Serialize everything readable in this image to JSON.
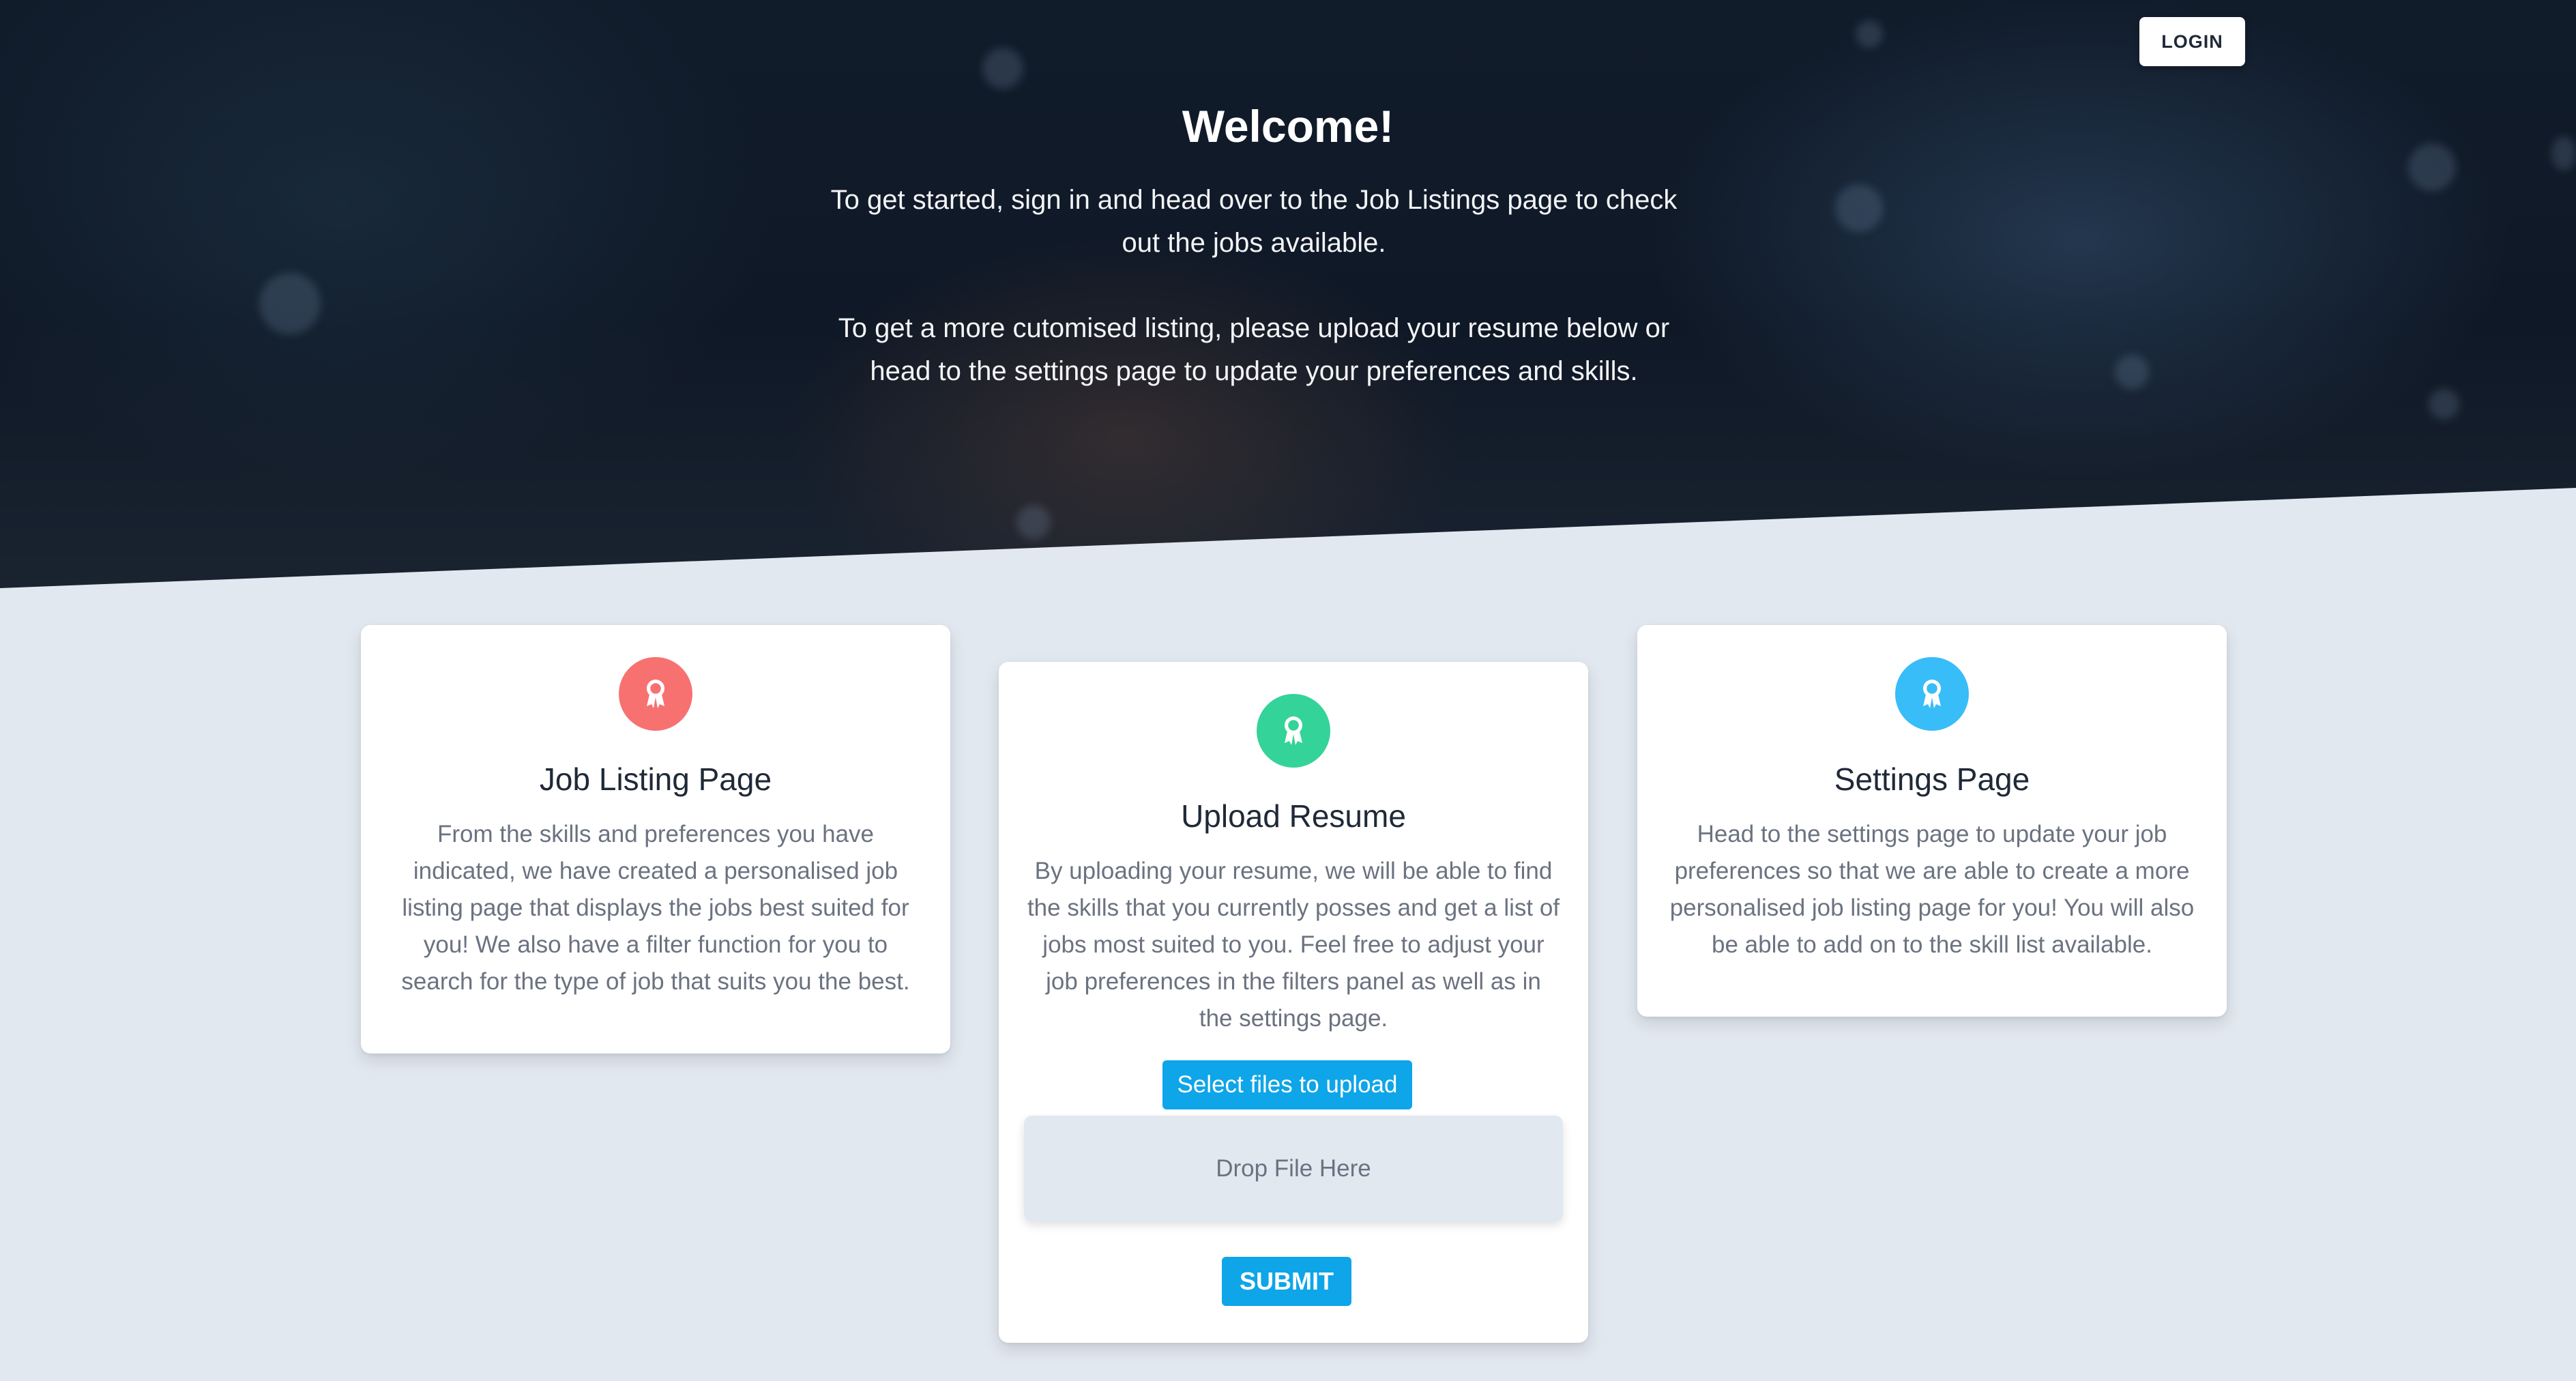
{
  "header": {
    "login_label": "LOGIN"
  },
  "hero": {
    "title": "Welcome!",
    "paragraph_1": "To get started, sign in and head over to the Job Listings page to check out the jobs available.",
    "paragraph_2": "To get a more cutomised listing, please upload your resume below or head to the settings page to update your preferences and skills."
  },
  "cards": [
    {
      "icon": "award-icon",
      "icon_color": "#f87171",
      "title": "Job Listing Page",
      "text": "From the skills and preferences you have indicated, we have created a personalised job listing page that displays the jobs best suited for you! We also have a filter function for you to search for the type of job that suits you the best."
    },
    {
      "icon": "award-icon",
      "icon_color": "#34d399",
      "title": "Upload Resume",
      "text": "By uploading your resume, we will be able to find the skills that you currently posses and get a list of jobs most suited to you. Feel free to adjust your job preferences in the filters panel as well as in the settings page.",
      "upload_button_label": "Select files to upload",
      "drop_zone_label": "Drop File Here",
      "submit_label": "SUBMIT"
    },
    {
      "icon": "award-icon",
      "icon_color": "#38bdf8",
      "title": "Settings Page",
      "text": "Head to the settings page to update your job preferences so that we are able to create a more personalised job listing page for you! You will also be able to add on to the skill list available."
    }
  ],
  "colors": {
    "page_background": "#e2e8f0",
    "accent_button": "#0ea5e9",
    "hero_background": "#111c2b"
  }
}
